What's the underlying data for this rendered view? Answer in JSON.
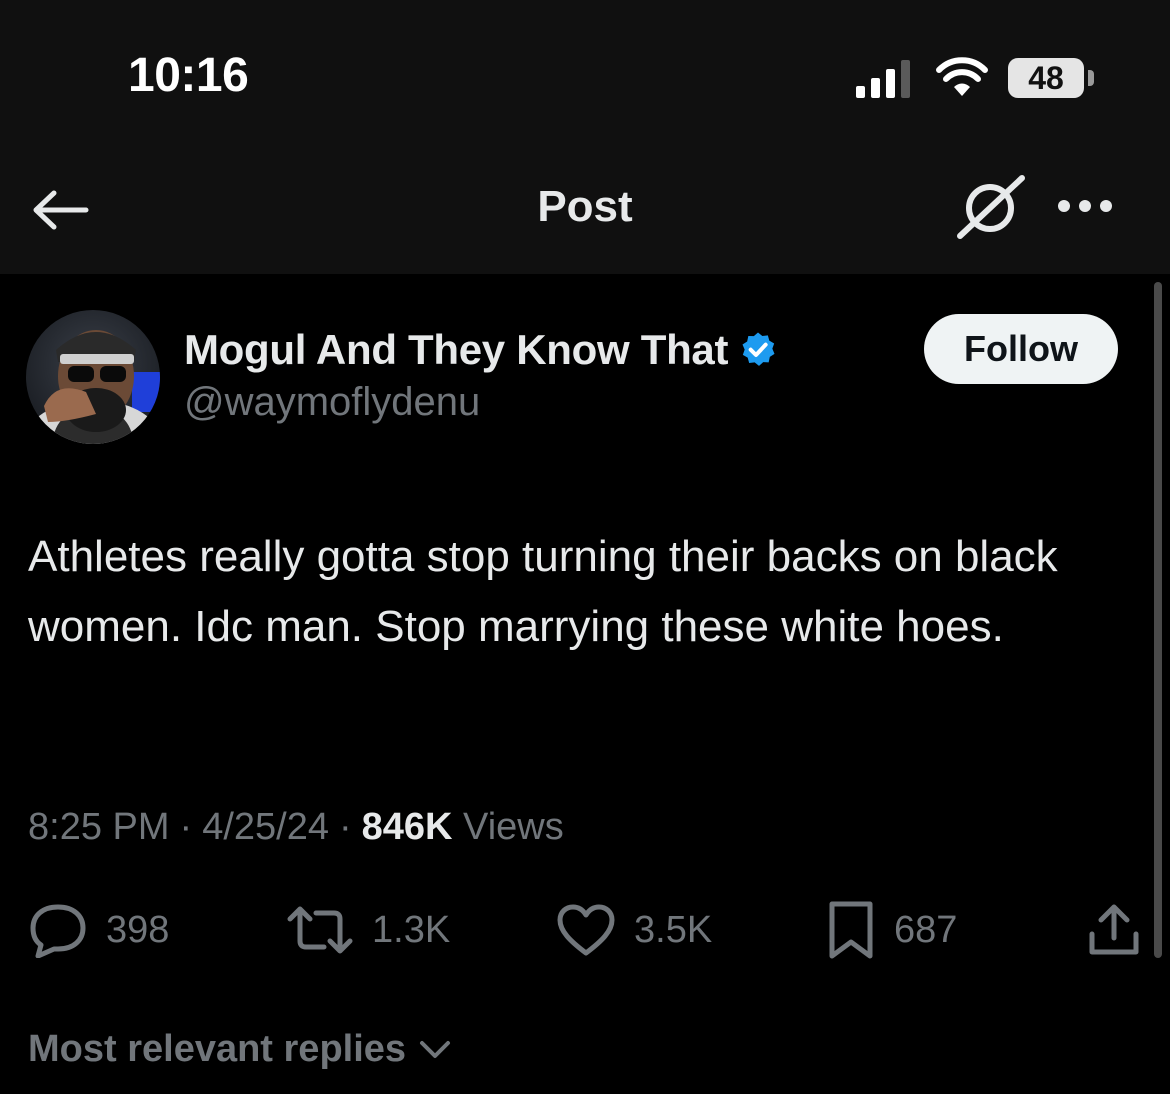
{
  "status_bar": {
    "time": "10:16",
    "battery": "48",
    "icons": [
      "signal-icon",
      "wifi-icon",
      "battery-icon"
    ]
  },
  "nav": {
    "title": "Post",
    "icons": [
      "back-arrow-icon",
      "grok-icon",
      "more-icon"
    ]
  },
  "author": {
    "name": "Mogul And They Know That",
    "handle": "@waymoflydenu",
    "verified": true,
    "follow_label": "Follow"
  },
  "tweet": {
    "text": "Athletes really gotta stop turning their backs on black women. Idc man. Stop marrying these white hoes."
  },
  "meta": {
    "time": "8:25 PM",
    "date": "4/25/24",
    "views_count": "846K",
    "views_label": "Views"
  },
  "actions": {
    "replies": "398",
    "reposts": "1.3K",
    "likes": "3.5K",
    "bookmarks": "687",
    "icons": [
      "reply-icon",
      "repost-icon",
      "like-icon",
      "bookmark-icon",
      "share-icon"
    ]
  },
  "replies_filter": {
    "label": "Most relevant replies"
  },
  "colors": {
    "background": "#000000",
    "bar": "#101010",
    "text": "#e7e9ea",
    "secondary": "#71767b",
    "verified": "#1d9bf0",
    "follow_bg": "#eff3f4"
  }
}
